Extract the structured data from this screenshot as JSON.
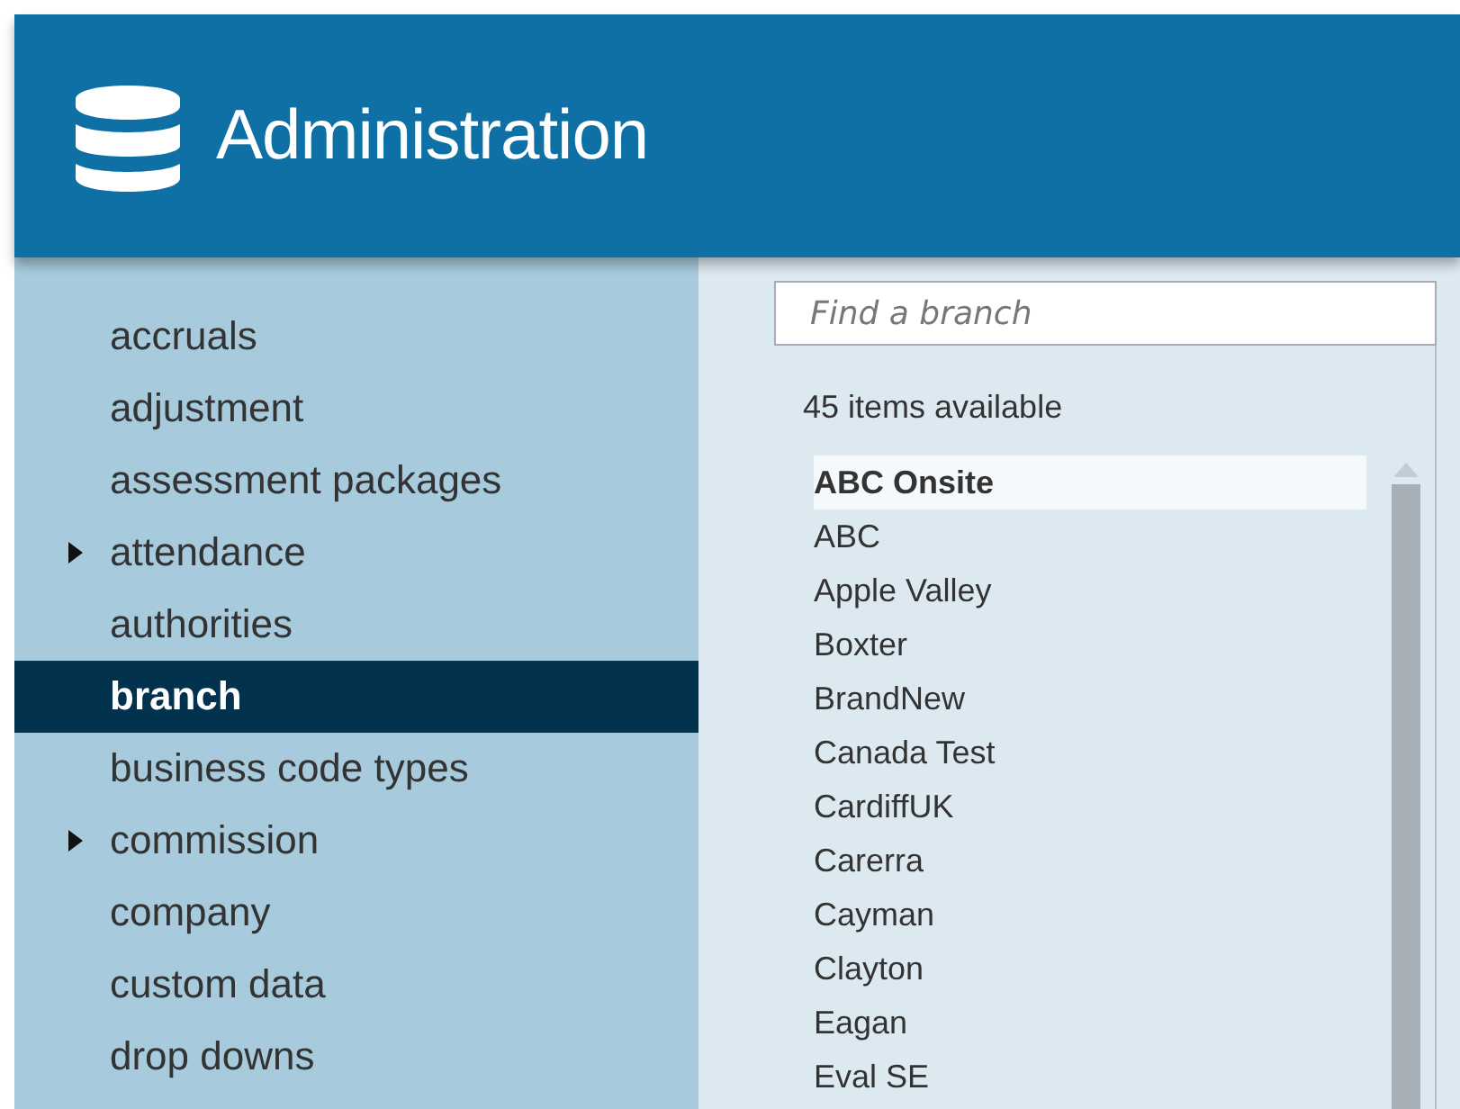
{
  "header": {
    "title": "Administration"
  },
  "sidebar": {
    "items": [
      {
        "label": "accruals",
        "kind": "leaf",
        "selected": false
      },
      {
        "label": "adjustment",
        "kind": "leaf",
        "selected": false
      },
      {
        "label": "assessment packages",
        "kind": "leaf",
        "selected": false
      },
      {
        "label": "attendance",
        "kind": "group",
        "selected": false
      },
      {
        "label": "authorities",
        "kind": "leaf",
        "selected": false
      },
      {
        "label": "branch",
        "kind": "leaf",
        "selected": true
      },
      {
        "label": "business code types",
        "kind": "leaf",
        "selected": false
      },
      {
        "label": "commission",
        "kind": "group",
        "selected": false
      },
      {
        "label": "company",
        "kind": "leaf",
        "selected": false
      },
      {
        "label": "custom data",
        "kind": "leaf",
        "selected": false
      },
      {
        "label": "drop downs",
        "kind": "leaf",
        "selected": false
      }
    ]
  },
  "branch_list": {
    "search": {
      "placeholder": "Find a branch"
    },
    "count": "45 items available",
    "items": [
      {
        "label": "ABC Onsite",
        "selected": true
      },
      {
        "label": "ABC",
        "selected": false
      },
      {
        "label": "Apple Valley",
        "selected": false
      },
      {
        "label": "Boxter",
        "selected": false
      },
      {
        "label": "BrandNew",
        "selected": false
      },
      {
        "label": "Canada Test",
        "selected": false
      },
      {
        "label": "CardiffUK",
        "selected": false
      },
      {
        "label": "Carerra",
        "selected": false
      },
      {
        "label": "Cayman",
        "selected": false
      },
      {
        "label": "Clayton",
        "selected": false
      },
      {
        "label": "Eagan",
        "selected": false
      },
      {
        "label": "Eval SE",
        "selected": false
      }
    ]
  }
}
